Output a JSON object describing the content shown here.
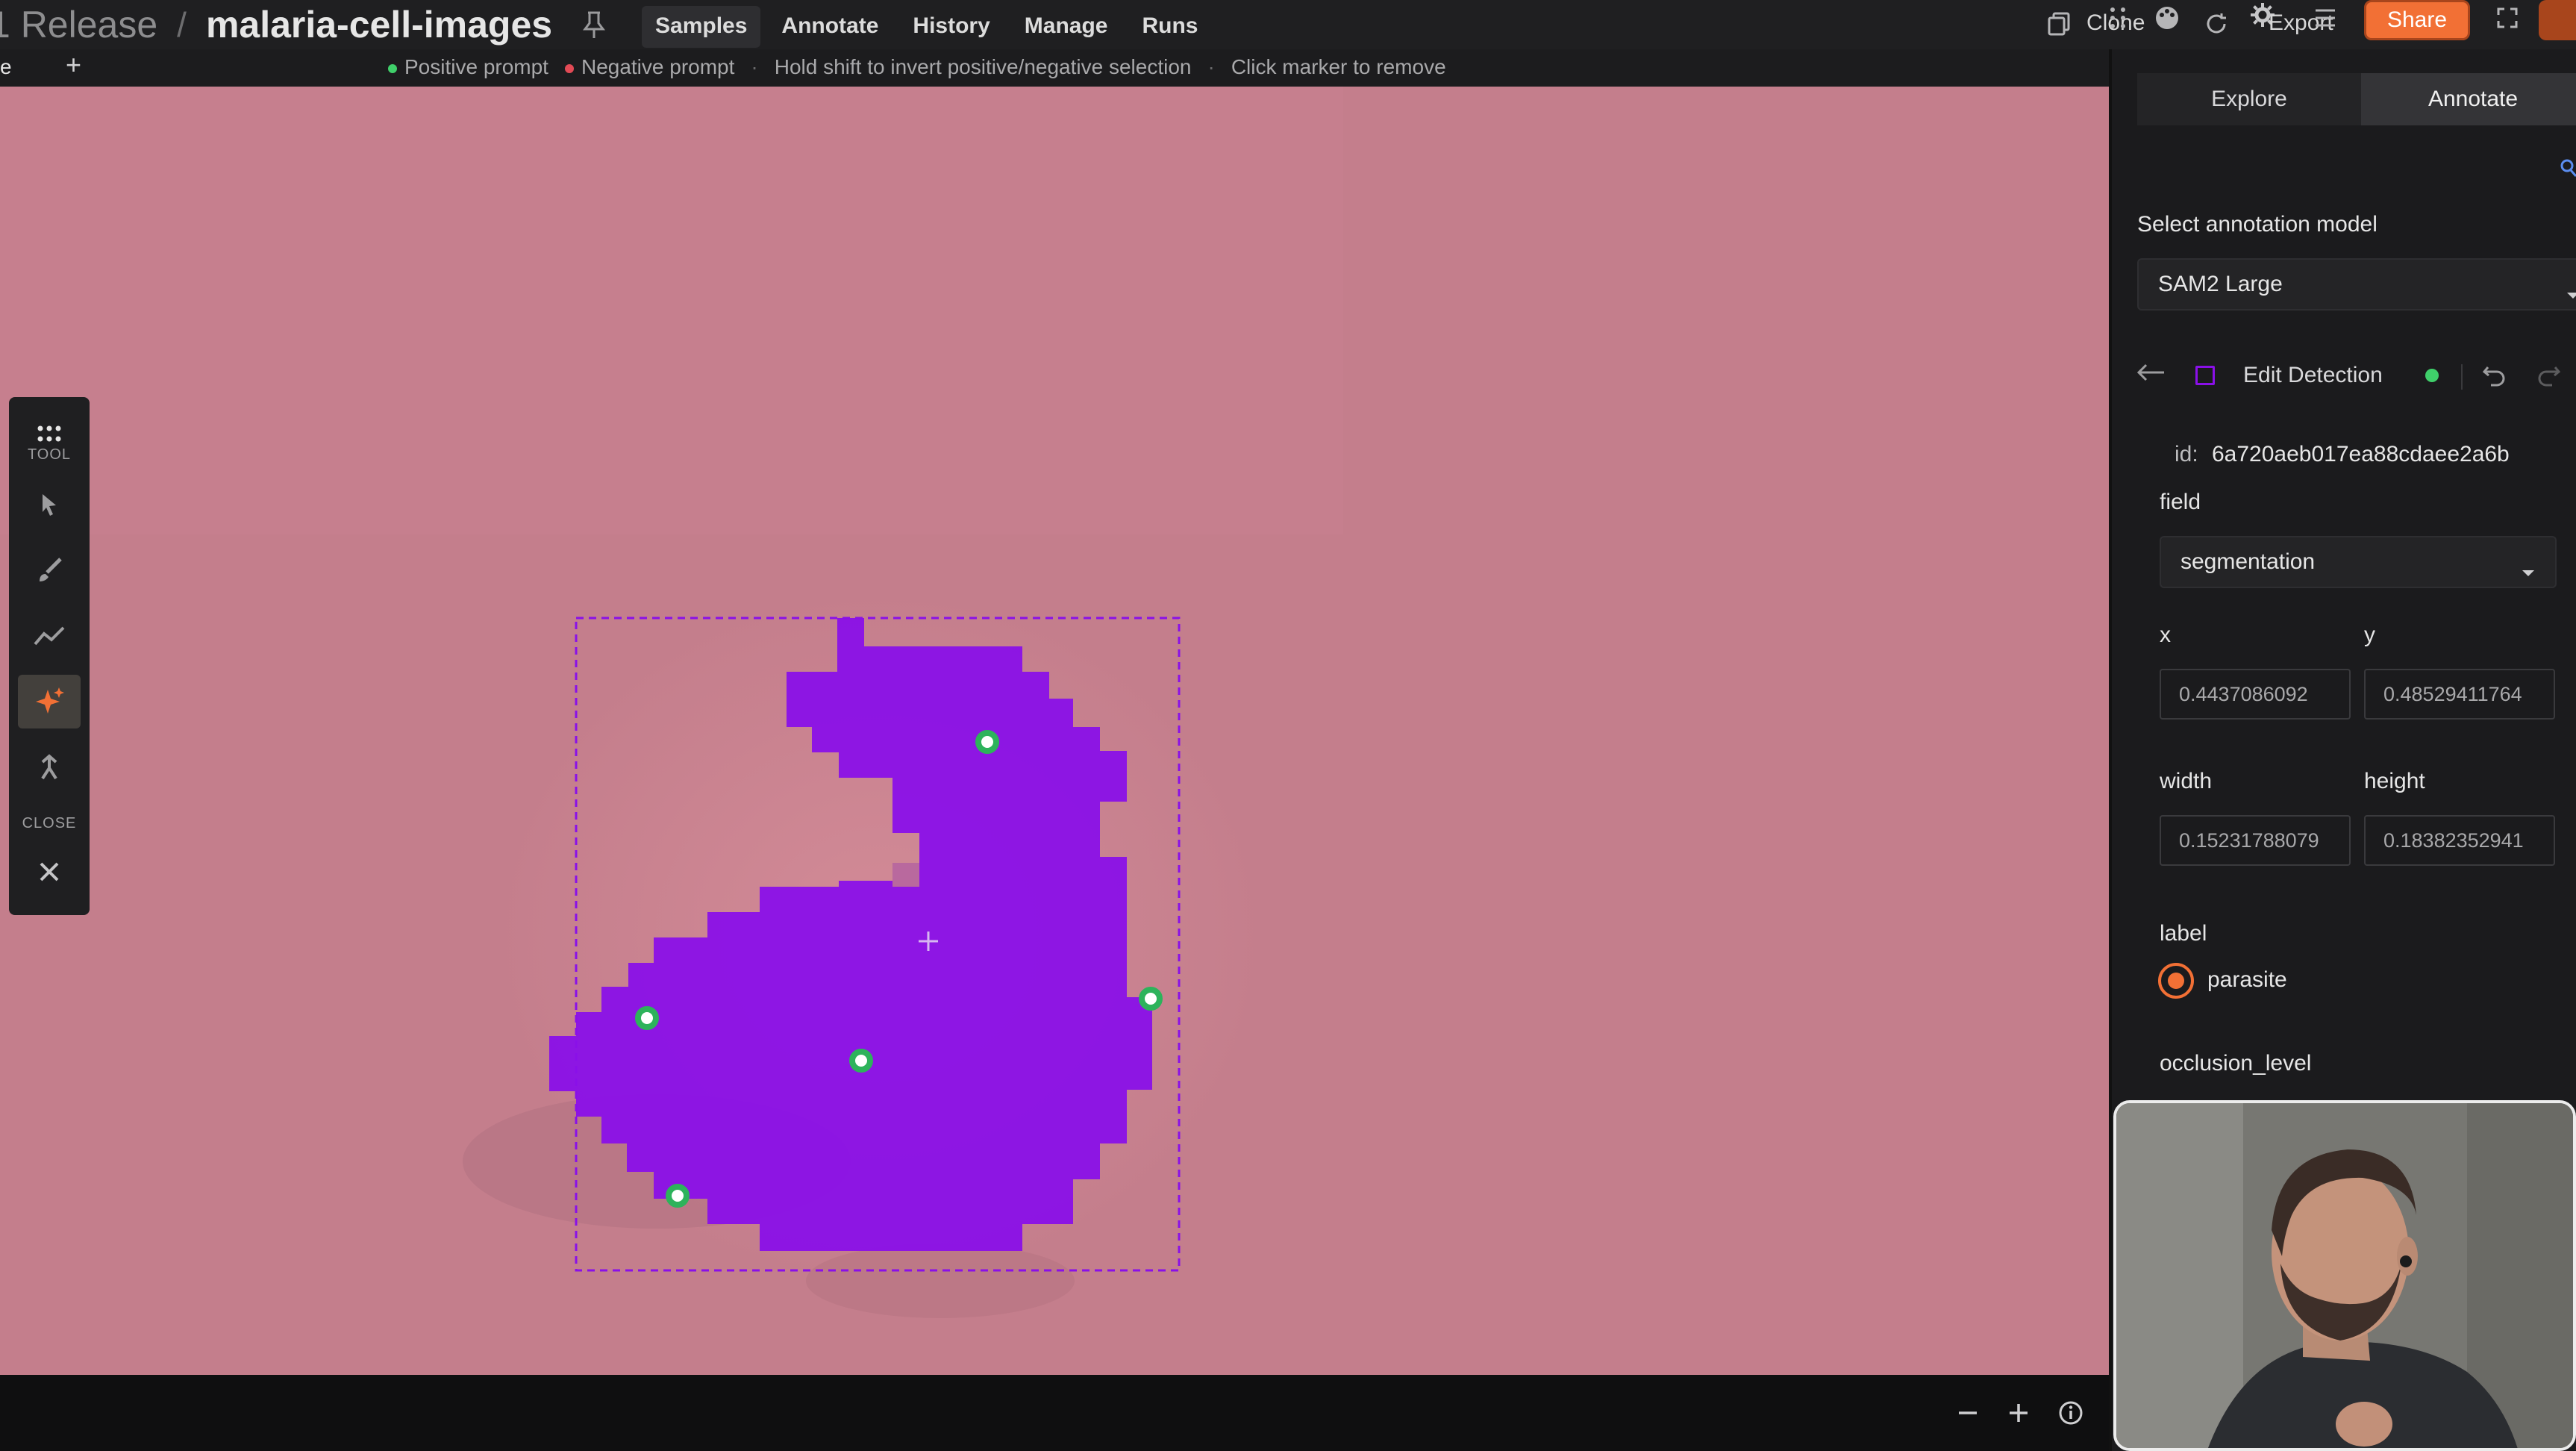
{
  "breadcrumb": {
    "prefix": "1 Release",
    "separator": "/",
    "dataset": "malaria-cell-images"
  },
  "nav_tabs": [
    "Samples",
    "Annotate",
    "History",
    "Manage",
    "Runs"
  ],
  "top_right": {
    "clone": "Clone",
    "export": "Export",
    "share": "Share"
  },
  "hintbar": {
    "left_label": "e",
    "positive": "Positive prompt",
    "negative": "Negative prompt",
    "invert_hint": "Hold shift to invert positive/negative selection",
    "remove_hint": "Click marker to remove",
    "separator": "·",
    "positive_color": "#3fcf6a",
    "negative_color": "#e24a55"
  },
  "tool_palette": {
    "tool_label": "TOOL",
    "close_label": "CLOSE",
    "tools": [
      "grid-icon",
      "pointer-icon",
      "brush-icon",
      "polyline-icon",
      "sparkle-icon",
      "pin-tool-icon"
    ],
    "active_tool": "sparkle-icon"
  },
  "panel": {
    "tabs": [
      "Explore",
      "Annotate"
    ],
    "active_tab": "Annotate",
    "model_label": "Select annotation model",
    "model_value": "SAM2 Large",
    "edit_title": "Edit Detection",
    "id_label": "id:",
    "id_value": "6a720aeb017ea88cdaee2a6b",
    "field_label": "field",
    "field_value": "segmentation",
    "x_label": "x",
    "x_value": "0.4437086092",
    "y_label": "y",
    "y_value": "0.48529411764",
    "width_label": "width",
    "width_value": "0.15231788079",
    "height_label": "height",
    "height_value": "0.18382352941",
    "label_label": "label",
    "label_value": "parasite",
    "occlusion_label": "occlusion_level",
    "accent_color": "#f27035",
    "mask_color": "#8a10e8"
  }
}
